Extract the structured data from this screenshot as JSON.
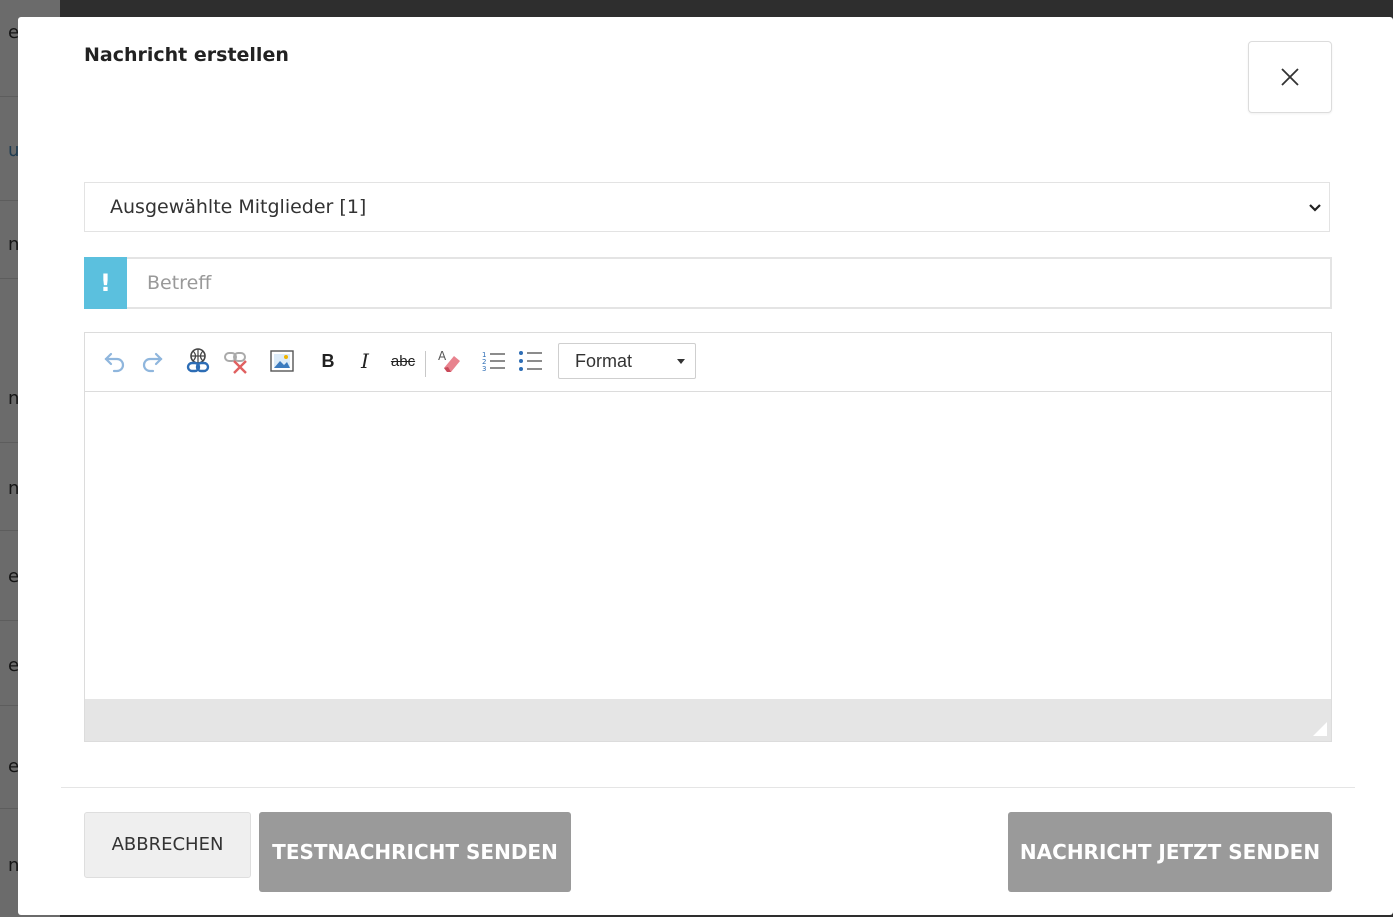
{
  "background": {
    "partial_chars": [
      "e",
      "u",
      "n",
      "n",
      "n",
      "e",
      "e",
      "e",
      "n"
    ]
  },
  "modal": {
    "title": "Nachricht erstellen",
    "close_icon": "close-icon"
  },
  "recipients": {
    "selected": "Ausgewählte Mitglieder [1]"
  },
  "subject": {
    "flag": "!",
    "value": "",
    "placeholder": "Betreff"
  },
  "editor": {
    "toolbar": {
      "icons": [
        "undo-icon",
        "redo-icon",
        "link-icon",
        "unlink-icon",
        "image-icon",
        "bold-icon",
        "italic-icon",
        "strikethrough-icon",
        "remove-format-icon",
        "numbered-list-icon",
        "bulleted-list-icon"
      ],
      "bold": "B",
      "italic": "I",
      "strike": "abc",
      "format_label": "Format"
    },
    "content": ""
  },
  "footer": {
    "cancel_label": "Abbrechen",
    "test_label": "Testnachricht senden",
    "send_label": "Nachricht jetzt senden"
  },
  "colors": {
    "flag": "#5bc0de",
    "primary_disabled": "#9a9a9a",
    "secondary": "#efefef"
  }
}
